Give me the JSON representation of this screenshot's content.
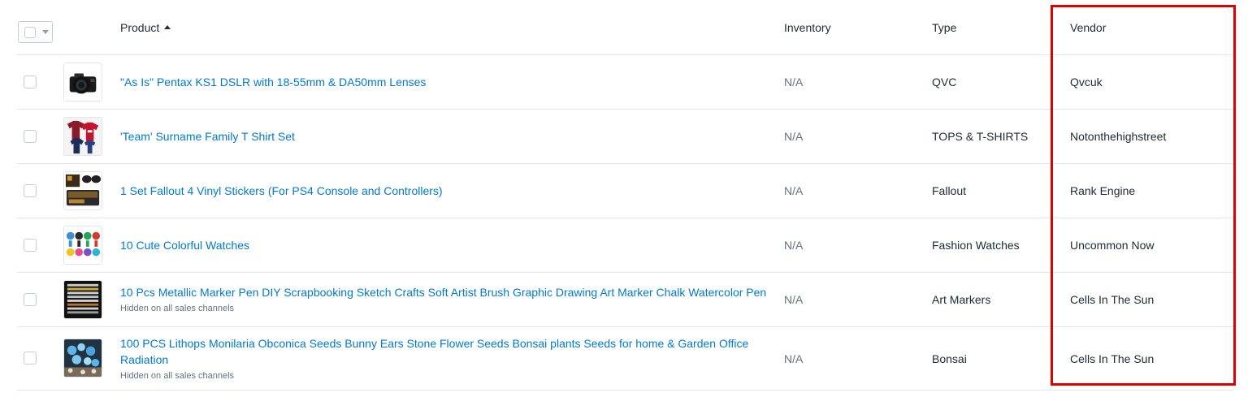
{
  "columns": {
    "product": "Product",
    "inventory": "Inventory",
    "type": "Type",
    "vendor": "Vendor"
  },
  "rows": [
    {
      "title": "\"As Is\" Pentax KS1 DSLR with 18-55mm & DA50mm Lenses",
      "subtitle": "",
      "inventory": "N/A",
      "type": "QVC",
      "vendor": "Qvcuk",
      "thumb_icon": "camera-thumbnail"
    },
    {
      "title": "'Team' Surname Family T Shirt Set",
      "subtitle": "",
      "inventory": "N/A",
      "type": "TOPS & T-SHIRTS",
      "vendor": "Notonthehighstreet",
      "thumb_icon": "tshirts-thumbnail"
    },
    {
      "title": "1 Set Fallout 4 Vinyl Stickers (For PS4 Console and Controllers)",
      "subtitle": "",
      "inventory": "N/A",
      "type": "Fallout",
      "vendor": "Rank Engine",
      "thumb_icon": "ps4-stickers-thumbnail"
    },
    {
      "title": "10 Cute Colorful Watches",
      "subtitle": "",
      "inventory": "N/A",
      "type": "Fashion Watches",
      "vendor": "Uncommon Now",
      "thumb_icon": "watches-thumbnail"
    },
    {
      "title": "10 Pcs Metallic Marker Pen DIY Scrapbooking Sketch Crafts Soft Artist Brush Graphic Drawing Art Marker Chalk Watercolor Pen",
      "subtitle": "Hidden on all sales channels",
      "inventory": "N/A",
      "type": "Art Markers",
      "vendor": "Cells In The Sun",
      "thumb_icon": "markers-thumbnail"
    },
    {
      "title": "100 PCS Lithops Monilaria Obconica Seeds Bunny Ears Stone Flower Seeds Bonsai plants Seeds for home & Garden Office Radiation",
      "subtitle": "Hidden on all sales channels",
      "inventory": "N/A",
      "type": "Bonsai",
      "vendor": "Cells In The Sun",
      "thumb_icon": "plants-thumbnail"
    }
  ],
  "colors": {
    "link": "#007ace",
    "muted": "#637381",
    "highlight": "#e00000",
    "border": "#e3e5e8"
  }
}
